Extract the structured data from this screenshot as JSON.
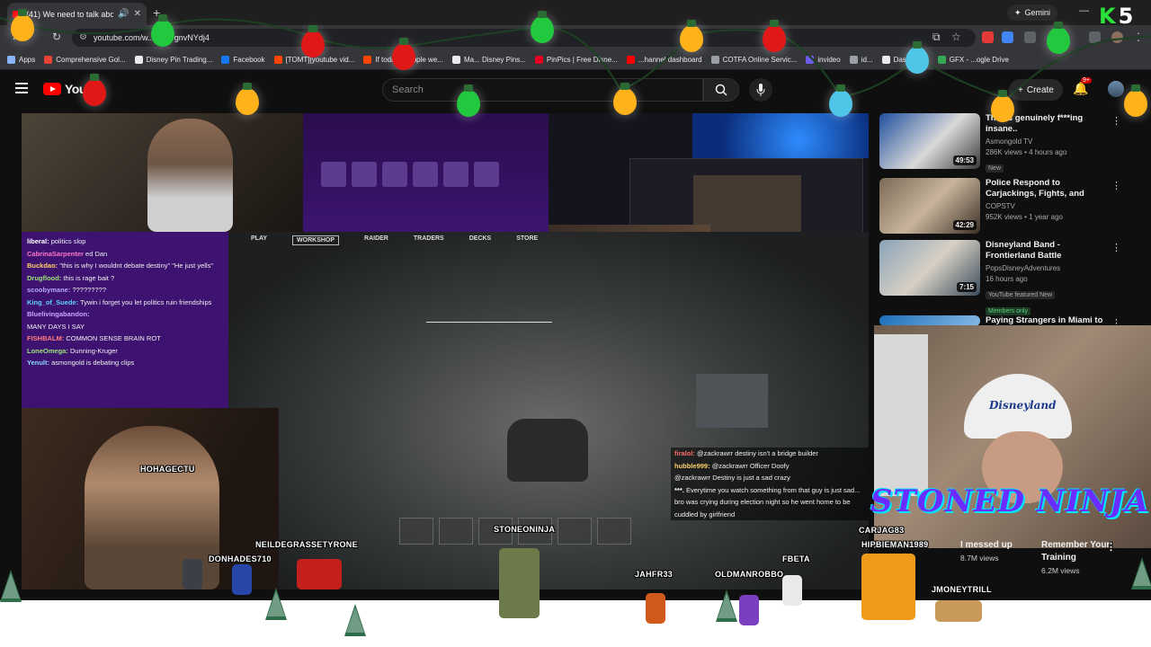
{
  "browser": {
    "tab_title": "(41) We need to talk about",
    "url": "youtube.com/w... =7s7gnvNYdj4",
    "gemini_label": "Gemini",
    "bookmarks": [
      {
        "label": "Apps",
        "color": "#8ab4f8"
      },
      {
        "label": "Comprehensive Gol...",
        "color": "#ea4335"
      },
      {
        "label": "Disney Pin Trading...",
        "color": "#e8eaed"
      },
      {
        "label": "Facebook",
        "color": "#1877f2"
      },
      {
        "label": "[TOMT][youtube vid...",
        "color": "#ff4500"
      },
      {
        "label": "If todays people we...",
        "color": "#ff4500"
      },
      {
        "label": "Ma... Disney Pins...",
        "color": "#e8eaed"
      },
      {
        "label": "PinPics | Free Disne...",
        "color": "#e60023"
      },
      {
        "label": "...hannel dashboard",
        "color": "#ff0000"
      },
      {
        "label": "COTFA Online Servic...",
        "color": "#9aa0a6"
      },
      {
        "label": "invideo",
        "color": "#6c5ce7"
      },
      {
        "label": "id...",
        "color": "#9aa0a6"
      },
      {
        "label": "Dashboard",
        "color": "#e8eaed"
      },
      {
        "label": "GFX - ...ogle Drive",
        "color": "#34a853"
      }
    ]
  },
  "youtube": {
    "logo_text": "YouT",
    "search_placeholder": "Search",
    "create_label": "Create",
    "notif_badge": "9+"
  },
  "stream": {
    "chat": [
      {
        "user": "liberal:",
        "msg": "politics slop"
      },
      {
        "user": "CabrinaSarpenter",
        "msg": "ed Dan"
      },
      {
        "user": "Buckdao:",
        "msg": "\"this is why I wouldnt debate destiny\" \"He just yells\""
      },
      {
        "user": "Drugflood:",
        "msg": "this is rage bait ?"
      },
      {
        "user": "scoobymane:",
        "msg": "?????????"
      },
      {
        "user": "King_of_Suede:",
        "msg": "Tywin i forget you let politics ruin friendships"
      },
      {
        "user": "Bluelivingabandon:",
        "msg": ""
      },
      {
        "user": "",
        "msg": "MANY DAYS I SAY"
      },
      {
        "user": "FISHBALM:",
        "msg": "COMMON SENSE BRAIN ROT"
      },
      {
        "user": "LoneOmega:",
        "msg": "Dunning-Kruger"
      },
      {
        "user": "Yenult:",
        "msg": "asmongold is debating clips"
      }
    ],
    "game_menu": [
      "PLAY",
      "WORKSHOP",
      "RAIDER",
      "TRADERS",
      "DECKS",
      "STORE"
    ],
    "active_menu": "WORKSHOP",
    "sub_chat": [
      {
        "user": "firalol:",
        "msg": "@zackrawrr destiny isn't a bridge builder"
      },
      {
        "user": "hubble999:",
        "msg": "@zackrawrr Officer Doofy"
      },
      {
        "user": "",
        "msg": "@zackrawrr Destiny is just a sad crazy"
      },
      {
        "user": "***.",
        "msg": "Everytime you watch something from that guy is just sad..."
      },
      {
        "user": "",
        "msg": "bro was crying during election night so he went home to be cuddled by girlfriend"
      }
    ],
    "overlay_names": {
      "hohagectu": "HOHAGECTU",
      "neil": "NEILDEGRASSETYRONE",
      "donhades": "DONHADES710",
      "stoneoninja": "STONEONINJA",
      "carjag": "CARJAG83",
      "hipbie": "HIPBIEMAN1989",
      "jahfr": "JAHFR33",
      "oldman": "OLDMANROBBO",
      "fbeta": "FBETA",
      "jmoney": "JMONEYTRILL"
    },
    "brand_title": "STONED NINJA",
    "cap_text": "Disneyland"
  },
  "sidebar": {
    "recs": [
      {
        "title": "This is genuinely f***ing insane..",
        "channel": "Asmongold TV",
        "stats": "286K views • 4 hours ago",
        "tag": "New",
        "duration": "49:53"
      },
      {
        "title": "Police Respond to Carjackings, Fights, and Suspicious Drivers ...",
        "channel": "COPSTV",
        "stats": "952K views • 1 year ago",
        "tag": "",
        "duration": "42:29"
      },
      {
        "title": "Disneyland Band - Frontierland Battle",
        "channel": "PopsDisneyAdventures",
        "stats": "16 hours ago",
        "tag": "YouTube featured  New",
        "tag2": "Members only",
        "duration": "7:15"
      },
      {
        "title": "Paying Strangers in Miami to",
        "channel": "",
        "stats": "",
        "tag": "",
        "duration": ""
      }
    ],
    "shorts": [
      {
        "title": "I messed up",
        "views": "8.7M views"
      },
      {
        "title": "Remember Your Training",
        "views": "6.2M views"
      }
    ]
  },
  "badge": {
    "letter": "K",
    "number": "5"
  },
  "colors": {
    "yt_red": "#ff0000",
    "bulb_yellow": "#ffb21a",
    "bulb_green": "#22c93f",
    "bulb_red": "#e01818",
    "bulb_blue": "#4fc6e8"
  }
}
